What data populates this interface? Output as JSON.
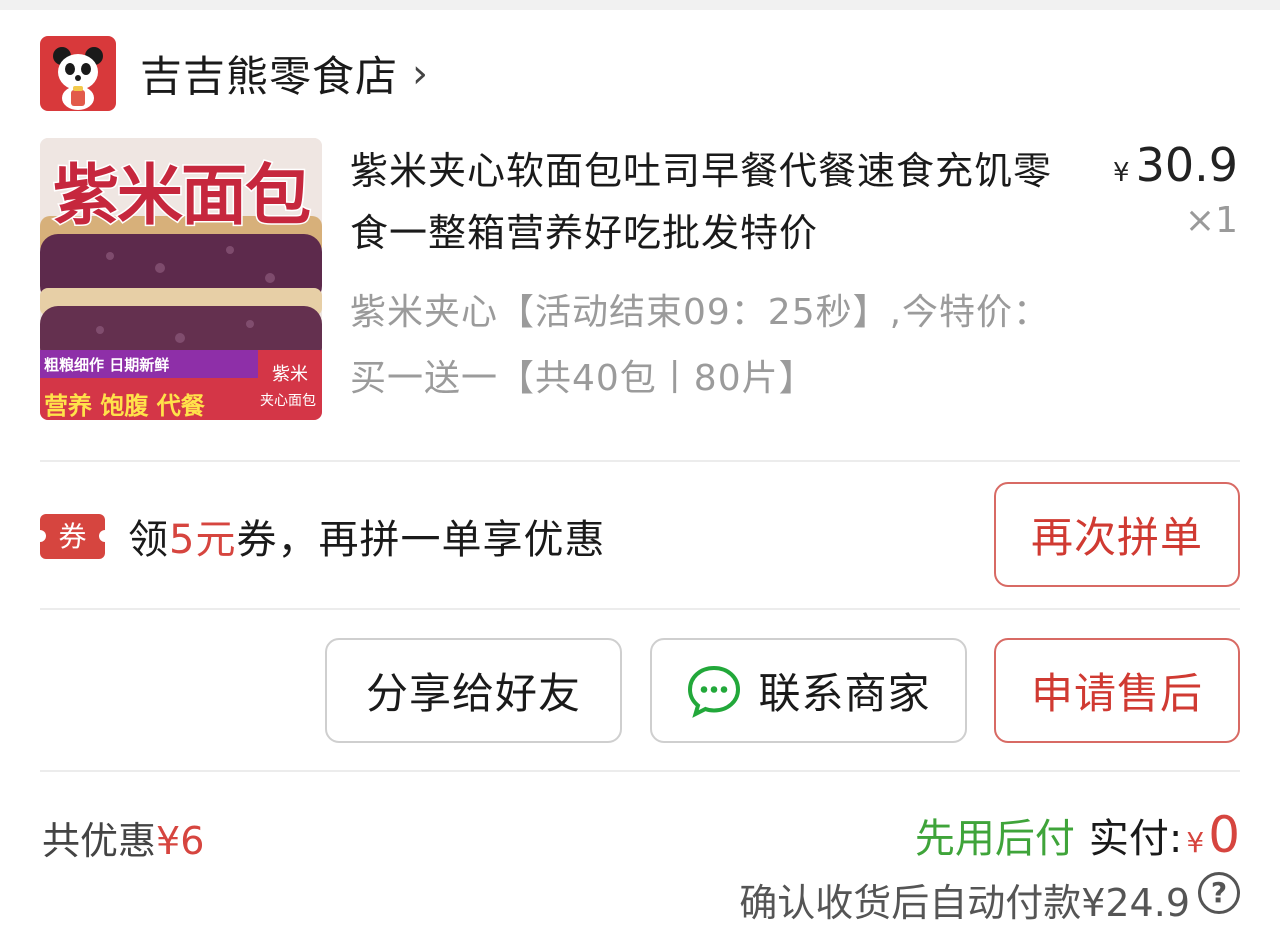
{
  "shop": {
    "name": "吉吉熊零食店",
    "chevron_icon": "chevron-right-icon",
    "logo_icon": "panda-logo-icon"
  },
  "product": {
    "thumbnail": {
      "headline": "紫米面包",
      "tagline": "粗粮细作 日期新鲜",
      "bottom_line": "营养 饱腹 代餐",
      "corner_top": "紫米",
      "corner_bottom": "夹心面包"
    },
    "title": "紫米夹心软面包吐司早餐代餐速食充饥零食一整箱营养好吃批发特价",
    "price_symbol": "¥",
    "price": "30.9",
    "quantity": "×1",
    "spec": "紫米夹心【活动结束09：25秒】,今特价：买一送一【共40包丨80片】"
  },
  "coupon": {
    "badge": "券",
    "text_prefix": "领",
    "amount": "5元",
    "text_suffix": "券，再拼一单享优惠",
    "button": "再次拼单"
  },
  "actions": {
    "share": "分享给好友",
    "contact": "联系商家",
    "contact_icon": "chat-bubble-icon",
    "after_sale": "申请售后"
  },
  "totals": {
    "discount_label": "共优惠",
    "discount_value": "¥6",
    "pay_later": "先用后付",
    "paid_label": "实付:",
    "paid_symbol": "¥",
    "paid_amount": "0",
    "auto_pay_note": "确认收货后自动付款¥24.9",
    "help_icon": "question-circle-icon"
  },
  "colors": {
    "accent_red": "#d6453f",
    "pay_later_green": "#3fa43a",
    "muted_text": "#9b9b9b"
  }
}
